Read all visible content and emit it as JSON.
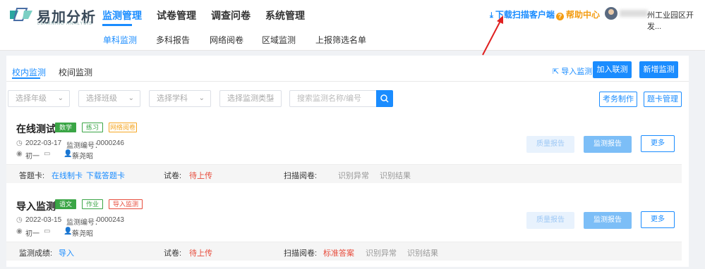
{
  "header": {
    "logo_cn": "易加分析",
    "logo_en": "LEARNING ANALYSIS",
    "nav": [
      "监测管理",
      "试卷管理",
      "调查问卷",
      "系统管理"
    ],
    "download_label": "下载扫描客户端",
    "help_label": "帮助中心",
    "user_name": "州工业园区开发..."
  },
  "subnav": [
    "单科监测",
    "多科报告",
    "网络阅卷",
    "区域监测",
    "上报筛选名单"
  ],
  "tabs": [
    "校内监测",
    "校间监测"
  ],
  "toolbar": {
    "import_label": "导入监测",
    "join_label": "加入联测",
    "new_label": "新增监测",
    "exam_label": "考务制作",
    "card_label": "题卡管理"
  },
  "filters": {
    "grade": "选择年级",
    "class": "选择班级",
    "subject": "选择学科",
    "type": "选择监测类型",
    "search_placeholder": "搜索监测名称/编号"
  },
  "cards": [
    {
      "title": "在线测试",
      "tags": [
        "数学",
        "练习",
        "网络阅卷"
      ],
      "date": "2022-03-17",
      "code_label": "监测编号：",
      "code": "0000246",
      "grade": "初一",
      "teacher": "蔡尧昭",
      "btn_quality": "质量报告",
      "btn_report": "监测报告",
      "btn_more": "更多",
      "foot": {
        "card_label": "答题卡:",
        "make_card": "在线制卡",
        "download_card": "下载答题卡",
        "paper_label": "试卷:",
        "paper_status": "待上传",
        "scan_label": "扫描阅卷:",
        "scan_items": [
          "识别异常",
          "识别结果"
        ]
      }
    },
    {
      "title": "导入监测",
      "tags": [
        "语文",
        "作业",
        "导入监测"
      ],
      "date": "2022-03-15",
      "code_label": "监测编号：",
      "code": "0000243",
      "grade": "初一",
      "teacher": "蔡尧昭",
      "btn_quality": "质量报告",
      "btn_report": "监测报告",
      "btn_more": "更多",
      "foot": {
        "score_label": "监测成绩:",
        "import": "导入",
        "paper_label": "试卷:",
        "paper_status": "待上传",
        "scan_label": "扫描阅卷:",
        "standard_answer": "标准答案",
        "scan_items": [
          "识别异常",
          "识别结果"
        ]
      }
    }
  ],
  "colors": {
    "primary": "#1a8cff",
    "warning": "#f39c12",
    "danger": "#e74c3c",
    "success": "#3aa545"
  }
}
